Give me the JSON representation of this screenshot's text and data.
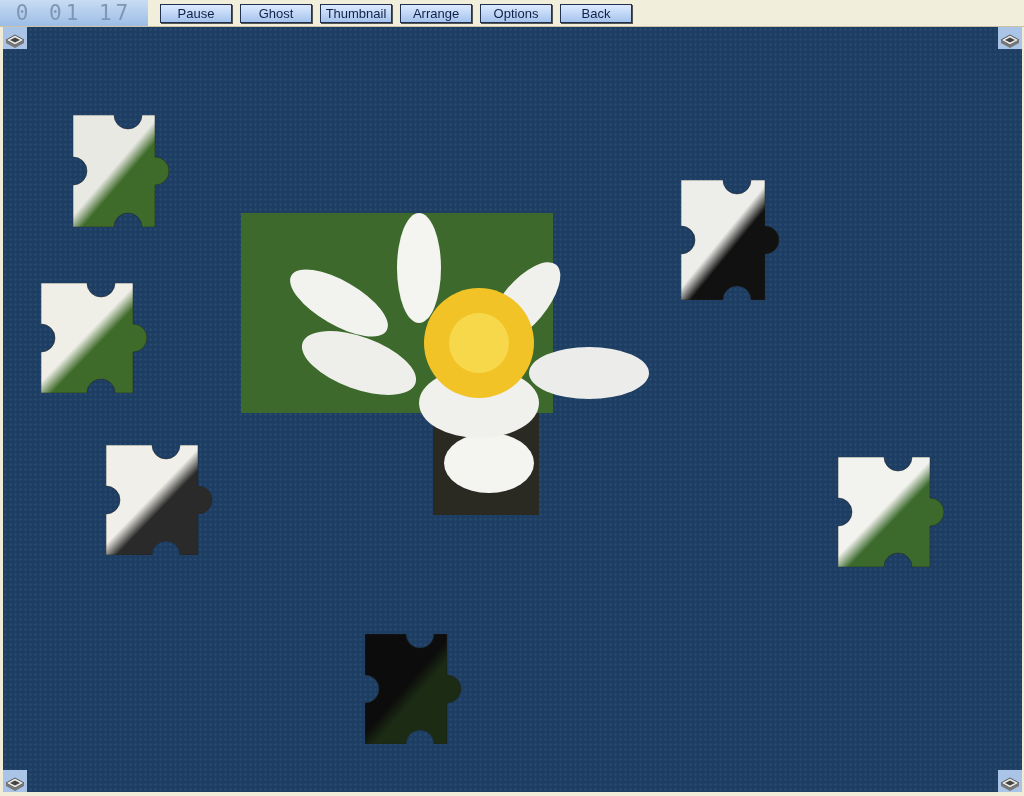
{
  "timer": "0 01 17",
  "buttons": [
    {
      "label": "Pause"
    },
    {
      "label": "Ghost"
    },
    {
      "label": "Thumbnail"
    },
    {
      "label": "Arrange"
    },
    {
      "label": "Options"
    },
    {
      "label": "Back"
    }
  ]
}
